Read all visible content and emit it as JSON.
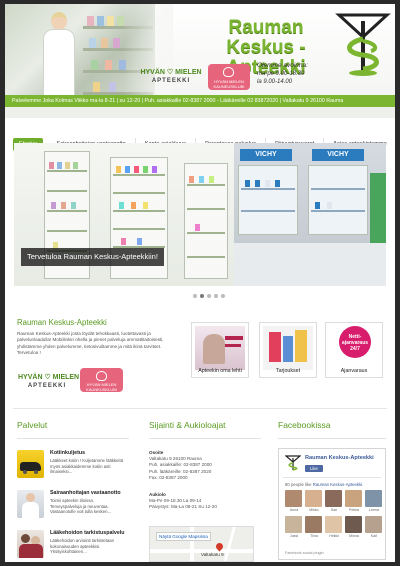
{
  "header": {
    "logo_line1": "Rauman",
    "logo_line2": "Keskus - Apteekki",
    "hyva_logo_top": "HYVÄN ♡ MIELEN",
    "hyva_logo_bottom": "APTEEKKI",
    "club_logo_text": "HYVÄN MIELEN KAUNEUSKLUBI",
    "hours_title": "Olemme avoinna:",
    "hours_weekdays": "ma-pe 9.00-18.30",
    "hours_saturday": "la 9.00-14.00",
    "info_bar": "Palvelemme Joka Kolmas Viikko ma-la 8-21 | su 12-20 | Puh. asiakkaille 02-8387 2000 - Lääkäreille 02 83872020 | Valtakatu 9 26100 Rauma"
  },
  "nav": {
    "items": [
      {
        "label": "Etusivu",
        "active": true
      },
      {
        "label": "Sairaanhoitajan vastaanotto",
        "active": false
      },
      {
        "label": "Kanta-asiakkuus",
        "active": false
      },
      {
        "label": "Parantavaa palvelua",
        "active": false
      },
      {
        "label": "Päivystysvuorot",
        "active": false
      },
      {
        "label": "Asiaa apteekistamme",
        "active": false
      }
    ]
  },
  "slider": {
    "caption": "Tervetuloa Rauman Keskus-Apteekkiin!",
    "banner_left": "VICHY",
    "banner_right": "VICHY",
    "dot_count": 5,
    "active_dot": 1
  },
  "intro": {
    "title": "Rauman Keskus-Apteekki",
    "text": "Rauman Keskus-Apteekki josta löydät tehokkaasti, luotettavasti ja palvelunlaadulla! Mobiilinkin ohella ja pienet palveluja ammattitaitoisesti, yhdistämme yhden palvelumme, tietosivuiltamme ja mitä ikinä tarvitset. Tervetuloa !",
    "hyva_top": "HYVÄN ♡ MIELEN",
    "hyva_bottom": "APTEEKKI",
    "club_text": "HYVÄN MIELEN KAUNEUSKLUBI"
  },
  "tiles": [
    {
      "label": "Apteekin oma lehti"
    },
    {
      "label": "Tarjoukset"
    },
    {
      "label": "Ajanvaraus",
      "badge_line1": "Netti-",
      "badge_line2": "ajanvaraus",
      "badge_line3": "24/7"
    }
  ],
  "sections": {
    "services_title": "Palvelut",
    "location_title": "Sijainti & Aukioloajat",
    "facebook_title": "Facebookissa"
  },
  "services": [
    {
      "title": "Kotiinkuljetus",
      "text": "Lääkkeet kotiin ! Kuljetamme lääkkeitä myös asiakkaidemme kotiin asti ilmaiseksi..."
    },
    {
      "title": "Sairaanhoitajan vastaanotto",
      "text": "Toimii apteekin tiloissa. Terveyspalveluja ja neuvontaa. Vastaanotolle voit tulla kesken..."
    },
    {
      "title": "Lääkehoidon tarkistuspalvelu",
      "text": "Lääkehoidon arviointi tarkistetaan kokonaisuuden apteekkisi. Yksityiskohtainen..."
    }
  ],
  "location": {
    "address_heading": "Osoite",
    "address_line1": "Valtakatu 9 26100 Rauma",
    "address_line2": "Puh. asiakkaille: 02-8387 2000",
    "address_line3": "Puh. lääkäreille: 02-8387 2020",
    "address_line4": "Fax. 02-8387 2000",
    "hours_heading": "Aukiolo",
    "hours_line1": "Ma-Pe 09-18.30 La 09-14",
    "hours_line2": "Päivystys: Ma-La 08-21 Su 12-20",
    "map_label": "Näytä Google Mapsissa",
    "map_street": "Valtakatu 9"
  },
  "facebook": {
    "page_name": "Rauman Keskus-Apteekki",
    "like_label": "Like",
    "count_prefix": "80 people like",
    "count_page": "Rauman Keskus-Apteekki.",
    "plugin_text": "Facebook social plugin",
    "people": [
      "Anna",
      "Mikko",
      "Sari",
      "Pekka",
      "Leena",
      "Jussi",
      "Tiina",
      "Heikki",
      "Minna",
      "Kari"
    ]
  },
  "colors": {
    "brand_green": "#7cb630",
    "heading_green": "#5a9a22",
    "club_pink": "#e7647d",
    "netti_magenta": "#d81d6c",
    "facebook_blue": "#3b5998"
  }
}
